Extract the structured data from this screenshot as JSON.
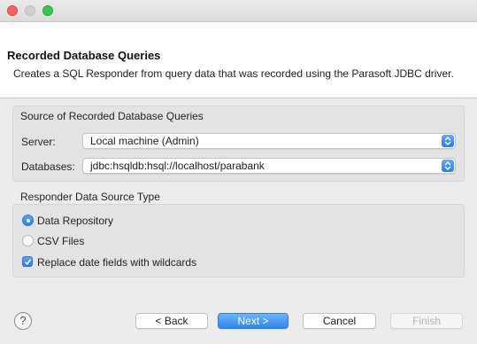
{
  "header": {
    "title": "Recorded Database Queries",
    "description": "Creates a SQL Responder from query data that was recorded using the Parasoft JDBC driver."
  },
  "source_group": {
    "label": "Source of Recorded Database Queries",
    "server_label": "Server:",
    "server_value": "Local machine (Admin)",
    "databases_label": "Databases:",
    "databases_value": "jdbc:hsqldb:hsql://localhost/parabank"
  },
  "responder_group": {
    "label": "Responder Data Source Type",
    "options": [
      {
        "label": "Data Repository",
        "selected": true
      },
      {
        "label": "CSV Files",
        "selected": false
      }
    ],
    "replace_label": "Replace date fields with wildcards",
    "replace_checked": true
  },
  "footer": {
    "help_label": "?",
    "back_label": "< Back",
    "next_label": "Next >",
    "cancel_label": "Cancel",
    "finish_label": "Finish"
  },
  "colors": {
    "accent": "#2f86ef",
    "close_light": "#fc605b",
    "max_light": "#34c84a"
  }
}
